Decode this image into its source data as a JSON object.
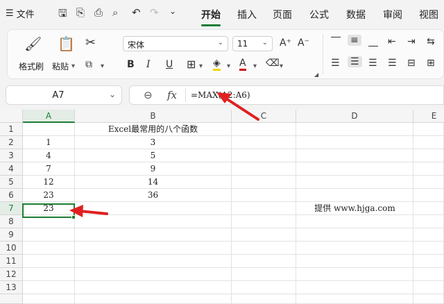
{
  "menubar": {
    "file_label": "文件",
    "tabs": [
      "开始",
      "插入",
      "页面",
      "公式",
      "数据",
      "审阅",
      "视图"
    ]
  },
  "ribbon": {
    "format_painter": "格式刷",
    "paste": "粘贴",
    "font_name": "宋体",
    "font_size": "11",
    "bold": "B",
    "italic": "I",
    "underline": "U",
    "font_color_glyph": "A",
    "grow_font": "A⁺",
    "shrink_font": "A⁻"
  },
  "formula_bar": {
    "name_box": "A7",
    "fx": "fx",
    "formula": "=MAX(A2:A6)"
  },
  "columns": [
    "A",
    "B",
    "C",
    "D",
    "E"
  ],
  "rows": [
    "1",
    "2",
    "3",
    "4",
    "5",
    "6",
    "7",
    "8",
    "9",
    "10",
    "11",
    "12",
    "13"
  ],
  "cells": {
    "B1": "Excel最常用的八个函数",
    "A2": "1",
    "B2": "3",
    "A3": "4",
    "B3": "5",
    "A4": "7",
    "B4": "9",
    "A5": "12",
    "B5": "14",
    "A6": "23",
    "B6": "36",
    "A7": "23",
    "D7": "提供 www.hjga.com"
  },
  "colors": {
    "accent": "#1e7e34",
    "arrow": "#e02020"
  }
}
